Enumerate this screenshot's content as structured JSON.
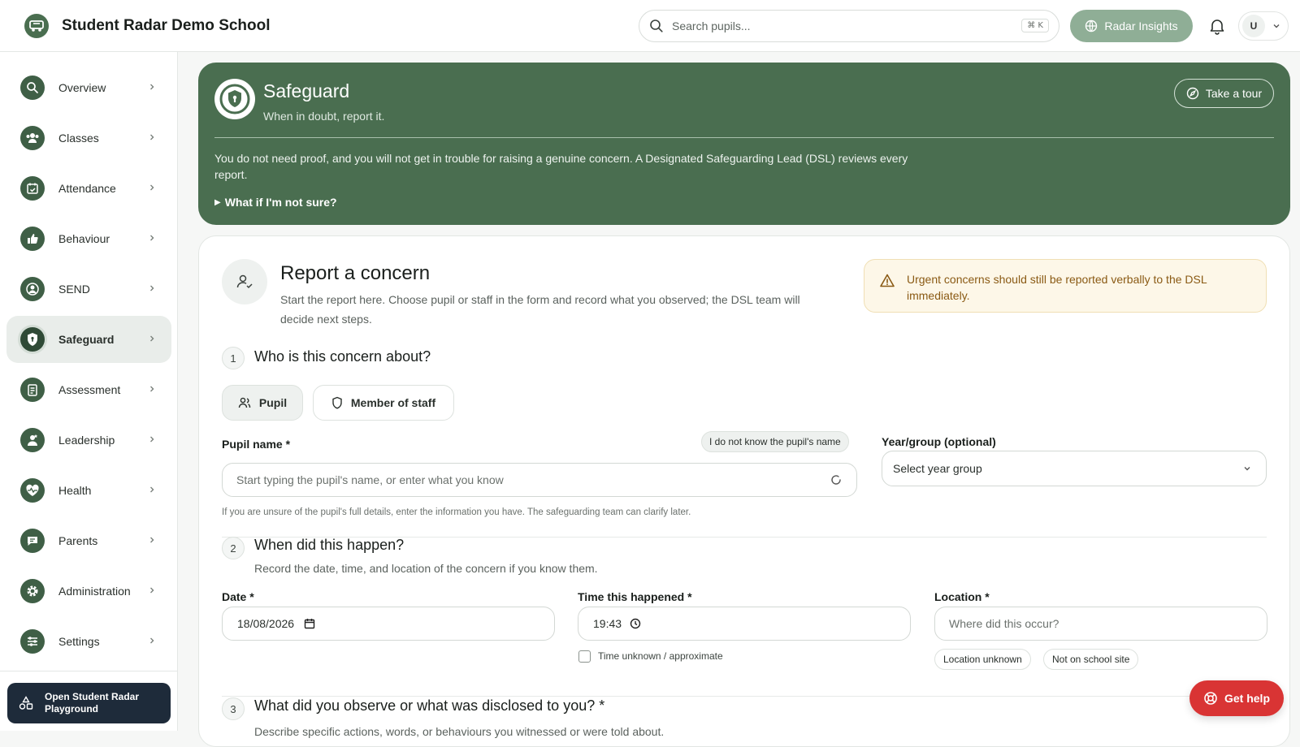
{
  "header": {
    "school_name": "Student Radar Demo School",
    "search_placeholder": "Search pupils...",
    "search_shortcut": "⌘ K",
    "insights_label": "Radar Insights",
    "user_initial": "U"
  },
  "sidebar": {
    "items": [
      {
        "label": "Overview"
      },
      {
        "label": "Classes"
      },
      {
        "label": "Attendance"
      },
      {
        "label": "Behaviour"
      },
      {
        "label": "SEND"
      },
      {
        "label": "Safeguard"
      },
      {
        "label": "Assessment"
      },
      {
        "label": "Leadership"
      },
      {
        "label": "Health"
      },
      {
        "label": "Parents"
      },
      {
        "label": "Administration"
      },
      {
        "label": "Settings"
      }
    ],
    "active": "Safeguard",
    "playground_line1": "Open Student Radar",
    "playground_line2": "Playground"
  },
  "banner": {
    "title": "Safeguard",
    "subtitle": "When in doubt, report it.",
    "tour_label": "Take a tour",
    "body": "You do not need proof, and you will not get in trouble for raising a genuine concern. A Designated Safeguarding Lead (DSL) reviews every report.",
    "details_label": "What if I'm not sure?"
  },
  "report": {
    "title": "Report a concern",
    "description": "Start the report here. Choose pupil or staff in the form and record what you observed; the DSL team will decide next steps.",
    "urgent_notice": "Urgent concerns should still be reported verbally to the DSL immediately."
  },
  "step1": {
    "number": "1",
    "title": "Who is this concern about?",
    "pupil_label": "Pupil",
    "staff_label": "Member of staff",
    "pupil_name_label": "Pupil name *",
    "unknown_name_label": "I do not know the pupil's name",
    "pupil_name_placeholder": "Start typing the pupil's name, or enter what you know",
    "helper": "If you are unsure of the pupil's full details, enter the information you have. The safeguarding team can clarify later.",
    "year_group_label": "Year/group (optional)",
    "year_group_value": "Select year group"
  },
  "step2": {
    "number": "2",
    "title": "When did this happen?",
    "subtitle": "Record the date, time, and location of the concern if you know them.",
    "date_label": "Date *",
    "date_value": "18/08/2026",
    "time_label": "Time this happened *",
    "time_value": "19:43",
    "time_unknown_label": "Time unknown / approximate",
    "location_label": "Location *",
    "location_placeholder": "Where did this occur?",
    "location_unknown": "Location unknown",
    "not_on_site": "Not on school site"
  },
  "step3": {
    "number": "3",
    "title": "What did you observe or what was disclosed to you? *",
    "subtitle": "Describe specific actions, words, or behaviours you witnessed or were told about."
  },
  "help": {
    "label": "Get help"
  },
  "colors": {
    "brand_green": "#4a6e50",
    "sidebar_icon": "#3f5f46",
    "urgent_bg": "#fdf7e8",
    "urgent_text": "#8a5a14",
    "help_red": "#d93434",
    "playground_navy": "#1e2b3a"
  },
  "icons": {
    "brand": "radar-logo-icon",
    "search": "search-icon",
    "insights": "globe-icon",
    "bell": "bell-icon",
    "chevron": "chevron-down-icon",
    "shield": "shield-lock-icon",
    "compass": "compass-icon",
    "warning": "warning-triangle-icon",
    "user_check": "user-check-icon",
    "users": "users-icon",
    "calendar": "calendar-icon",
    "clock": "clock-icon",
    "spinner": "loading-spinner-icon",
    "lifebuoy": "lifebuoy-icon"
  }
}
